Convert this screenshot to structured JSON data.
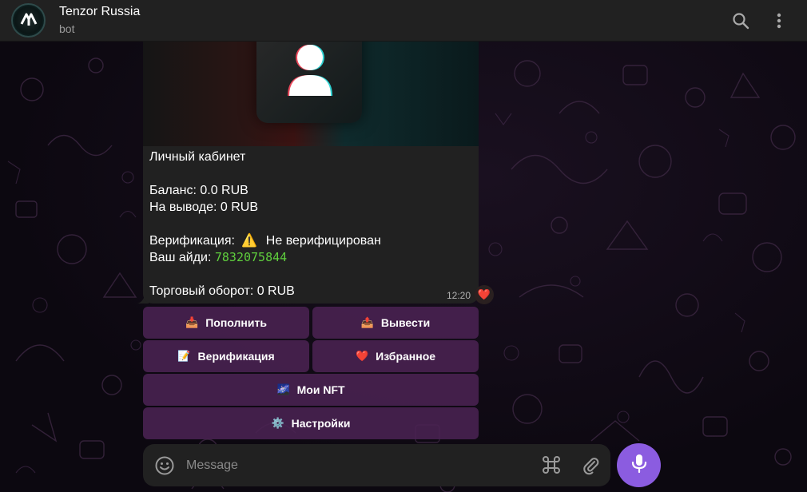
{
  "header": {
    "title": "Tenzor Russia",
    "subtitle": "bot",
    "avatar_icon": "tenzor-logo-icon",
    "search_icon": "search-icon",
    "menu_icon": "more-vertical-icon"
  },
  "message": {
    "photo_icon": "user-silhouette-icon",
    "lines": {
      "title": "Личный кабинет",
      "balance": "Баланс: 0.0 RUB",
      "withdrawal": "На выводе: 0 RUB",
      "verification_label": "Верификация:",
      "verification_emoji": "⚠️",
      "verification_status": "Не верифицирован",
      "id_label": "Ваш айди:",
      "id_value": "7832075844",
      "turnover": "Торговый оборот: 0 RUB"
    },
    "time": "12:20",
    "reaction": "❤️"
  },
  "keyboard": {
    "deposit": {
      "emoji": "📥",
      "label": "Пополнить"
    },
    "withdraw": {
      "emoji": "📤",
      "label": "Вывести"
    },
    "verification": {
      "emoji": "📝",
      "label": "Верификация"
    },
    "favorites": {
      "emoji": "❤️",
      "label": "Избранное"
    },
    "my_nft": {
      "emoji": "🌌",
      "label": "Мои NFT"
    },
    "settings": {
      "emoji": "⚙️",
      "label": "Настройки"
    }
  },
  "composer": {
    "placeholder": "Message",
    "emoji_icon": "smile-icon",
    "command_icon": "command-icon",
    "attach_icon": "paperclip-icon",
    "mic_icon": "microphone-icon"
  },
  "colors": {
    "header_bg": "#212121",
    "bubble_bg": "#212121",
    "keyboard_bg": "#4a2252",
    "accent": "#8b5ce0",
    "id_color": "#5fcf3d"
  }
}
